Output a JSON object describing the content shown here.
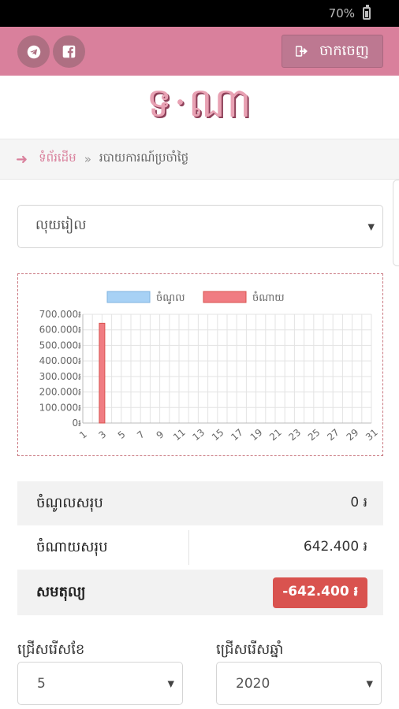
{
  "status": {
    "battery": "70%"
  },
  "header": {
    "logout_label": "ចាកចេញ"
  },
  "logo": {
    "text": "ទ·ណា"
  },
  "breadcrumb": {
    "home": "ទំព័រដើម",
    "separator": "»",
    "current": "របាយការណ៍ប្រចាំថ្ងៃ"
  },
  "top_select": {
    "value": "លុយរៀល"
  },
  "chart_data": {
    "type": "bar",
    "title": "",
    "xlabel": "",
    "ylabel": "",
    "ylim": [
      0,
      700000
    ],
    "legend_position": "top",
    "grid": true,
    "categories": [
      1,
      2,
      3,
      4,
      5,
      6,
      7,
      8,
      9,
      10,
      11,
      12,
      13,
      14,
      15,
      16,
      17,
      18,
      19,
      20,
      21,
      22,
      23,
      24,
      25,
      26,
      27,
      28,
      29,
      30,
      31
    ],
    "x_tick_labels": [
      "1",
      "3",
      "5",
      "7",
      "9",
      "11",
      "13",
      "15",
      "17",
      "19",
      "21",
      "23",
      "25",
      "27",
      "29",
      "31"
    ],
    "y_tick_labels": [
      "0៛",
      "100.000៛",
      "200.000៛",
      "300.000៛",
      "400.000៛",
      "500.000៛",
      "600.000៛",
      "700.000៛"
    ],
    "series": [
      {
        "name": "ចំណូល",
        "color": "#a7d1f5",
        "values": [
          0,
          0,
          0,
          0,
          0,
          0,
          0,
          0,
          0,
          0,
          0,
          0,
          0,
          0,
          0,
          0,
          0,
          0,
          0,
          0,
          0,
          0,
          0,
          0,
          0,
          0,
          0,
          0,
          0,
          0,
          0
        ]
      },
      {
        "name": "ចំណាយ",
        "color": "#f07c82",
        "values": [
          0,
          0,
          642400,
          0,
          0,
          0,
          0,
          0,
          0,
          0,
          0,
          0,
          0,
          0,
          0,
          0,
          0,
          0,
          0,
          0,
          0,
          0,
          0,
          0,
          0,
          0,
          0,
          0,
          0,
          0,
          0
        ]
      }
    ]
  },
  "summary": {
    "income_label": "ចំណូលសរុប",
    "income_value": "0 ៛",
    "expense_label": "ចំណាយសរុប",
    "expense_value": "642.400 ៛",
    "balance_label": "សមតុល្យ",
    "balance_value": "-642.400 ៛"
  },
  "filters": {
    "month_label": "ជ្រើសរើសខែ",
    "month_value": "5",
    "year_label": "ជ្រើសរើសឆ្នាំ",
    "year_value": "2020"
  },
  "colors": {
    "header": "#d9809c",
    "accent": "#d9809c",
    "danger": "#d9534f"
  },
  "icons": [
    "telegram-icon",
    "facebook-icon",
    "logout-icon",
    "back-arrow-icon",
    "caret-down-icon"
  ]
}
